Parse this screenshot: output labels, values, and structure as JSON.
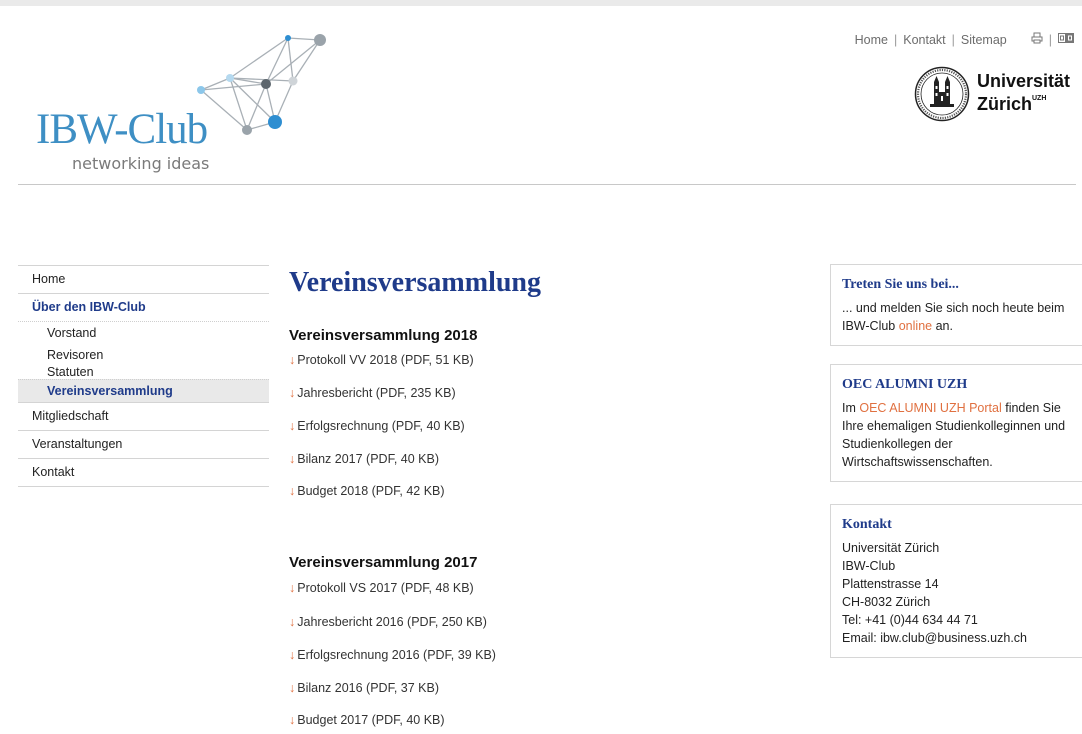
{
  "header": {
    "logo_title": "IBW-Club",
    "logo_subtitle": "networking ideas",
    "utility_links": [
      "Home",
      "Kontakt",
      "Sitemap"
    ],
    "icons": [
      "print-icon",
      "language-icon"
    ],
    "university": {
      "line1": "Universität",
      "line2": "Zürich",
      "sup": "UZH"
    }
  },
  "nav": {
    "home": "Home",
    "about": "Über den IBW-Club",
    "sub": [
      "Vorstand",
      "Revisoren",
      "Statuten",
      "Vereinsversammlung"
    ],
    "membership": "Mitgliedschaft",
    "events": "Veranstaltungen",
    "contact": "Kontakt"
  },
  "main": {
    "title": "Vereinsversammlung",
    "sections": [
      {
        "title": "Vereinsversammlung 2018",
        "files": [
          "Protokoll VV 2018 (PDF, 51 KB)",
          "Jahresbericht (PDF, 235 KB)",
          "Erfolgsrechnung (PDF, 40 KB)",
          "Bilanz 2017 (PDF, 40 KB)",
          "Budget 2018 (PDF, 42 KB)"
        ]
      },
      {
        "title": "Vereinsversammlung 2017",
        "files": [
          "Protokoll VS 2017 (PDF, 48 KB)",
          "Jahresbericht 2016 (PDF, 250 KB)",
          "Erfolgsrechnung 2016 (PDF, 39 KB)",
          "Bilanz 2016 (PDF, 37 KB)",
          "Budget 2017 (PDF, 40 KB)"
        ]
      }
    ],
    "arrow_glyph": "↓"
  },
  "sidebar": {
    "join": {
      "title": "Treten Sie uns bei...",
      "text_before": "... und melden Sie sich noch heute beim IBW-Club ",
      "link": "online",
      "text_after": " an."
    },
    "alumni": {
      "title": "OEC ALUMNI UZH",
      "text_before": "Im ",
      "link": "OEC ALUMNI UZH Portal",
      "text_after": " finden Sie Ihre ehemaligen Studienkolleginnen und Studienkollegen der Wirtschaftswissenschaften."
    },
    "contact": {
      "title": "Kontakt",
      "lines": [
        "Universität Zürich",
        "IBW-Club",
        "Plattenstrasse 14",
        "CH-8032 Zürich",
        "Tel: +41 (0)44 634 44 71",
        "Email: ibw.club@business.uzh.ch"
      ]
    }
  },
  "colors": {
    "accent_blue": "#1f3b8a",
    "logo_blue": "#3e8fc4",
    "link_orange": "#e07040"
  }
}
